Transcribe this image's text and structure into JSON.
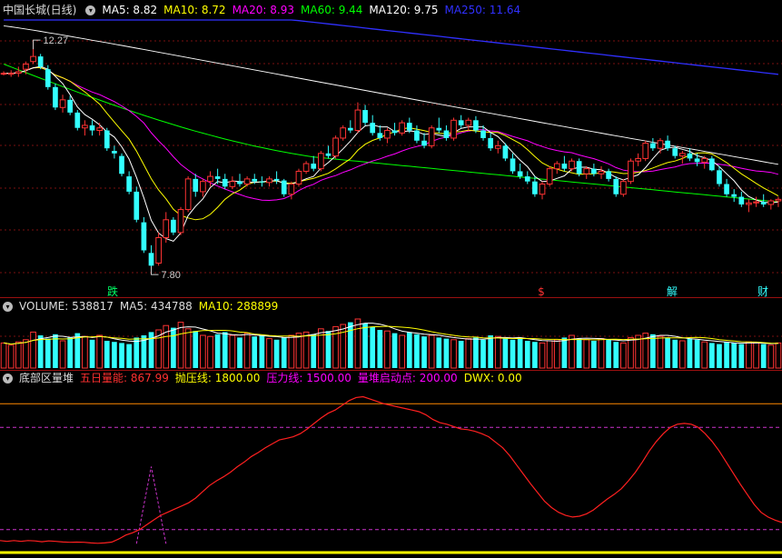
{
  "colors": {
    "ma5": "#ffffff",
    "ma10": "#ffff00",
    "ma20": "#ff00ff",
    "ma60": "#00ff00",
    "ma120": "#ffffff",
    "ma250": "#3030ff",
    "up": "#ff3333",
    "down": "#33ffff",
    "pressure": "#cc33cc",
    "energy": "#ff2020"
  },
  "price_panel": {
    "title": "中国长城(日线)",
    "toggle_icon": "chevron-down-icon",
    "ma": [
      {
        "label": "MA5: 8.82",
        "key": "ma5"
      },
      {
        "label": "MA10: 8.72",
        "key": "ma10"
      },
      {
        "label": "MA20: 8.93",
        "key": "ma20"
      },
      {
        "label": "MA60: 9.44",
        "key": "ma60"
      },
      {
        "label": "MA120: 9.75",
        "key": "ma120"
      },
      {
        "label": "MA250: 11.64",
        "key": "ma250"
      }
    ],
    "high_label": "12.27",
    "low_label": "7.80",
    "event_tags": [
      "跌",
      "$",
      "解",
      "财"
    ]
  },
  "volume_panel": {
    "labels": [
      {
        "text": "VOLUME: 538817",
        "key": "label"
      },
      {
        "text": "MA5: 434788",
        "key": "ma5"
      },
      {
        "text": "MA10: 288899",
        "key": "ma10"
      }
    ]
  },
  "indicator_panel": {
    "title": "底部区量堆",
    "labels": [
      {
        "text": "五日量能: 867.99",
        "key": "energy"
      },
      {
        "text": "抛压线: 1800.00",
        "key": "throw"
      },
      {
        "text": "压力线: 1500.00",
        "key": "pressure"
      },
      {
        "text": "量堆启动点: 200.00",
        "key": "start"
      },
      {
        "text": "DWX: 0.00",
        "key": "dwx"
      }
    ]
  },
  "chart_data": [
    {
      "type": "candlestick",
      "title": "中国长城(日线)",
      "ylim": [
        7.5,
        12.7
      ],
      "annotations": [
        {
          "text": "12.27",
          "value": 12.27
        },
        {
          "text": "7.80",
          "value": 7.8
        }
      ],
      "candles": [
        [
          11.62,
          11.66,
          11.58,
          11.62
        ],
        [
          11.6,
          11.68,
          11.55,
          11.62
        ],
        [
          11.62,
          11.75,
          11.55,
          11.65
        ],
        [
          11.7,
          11.85,
          11.6,
          11.8
        ],
        [
          11.85,
          12.27,
          11.8,
          11.95
        ],
        [
          11.95,
          12.0,
          11.7,
          11.75
        ],
        [
          11.7,
          11.78,
          11.3,
          11.35
        ],
        [
          11.35,
          11.42,
          10.9,
          10.95
        ],
        [
          10.95,
          11.2,
          10.85,
          11.1
        ],
        [
          11.1,
          11.18,
          10.8,
          10.85
        ],
        [
          10.85,
          10.9,
          10.5,
          10.55
        ],
        [
          10.55,
          10.7,
          10.4,
          10.6
        ],
        [
          10.6,
          10.7,
          10.4,
          10.5
        ],
        [
          10.5,
          10.65,
          10.4,
          10.55
        ],
        [
          10.5,
          10.55,
          10.1,
          10.15
        ],
        [
          10.1,
          10.2,
          9.95,
          10.05
        ],
        [
          10.0,
          10.05,
          9.6,
          9.65
        ],
        [
          9.6,
          9.7,
          9.25,
          9.3
        ],
        [
          9.3,
          9.4,
          8.7,
          8.75
        ],
        [
          8.7,
          8.8,
          8.1,
          8.15
        ],
        [
          8.1,
          8.25,
          7.8,
          7.85
        ],
        [
          7.9,
          8.5,
          7.85,
          8.4
        ],
        [
          8.4,
          8.9,
          8.3,
          8.75
        ],
        [
          8.75,
          8.8,
          8.45,
          8.5
        ],
        [
          8.5,
          9.0,
          8.45,
          8.95
        ],
        [
          8.95,
          9.6,
          8.9,
          9.55
        ],
        [
          9.55,
          9.65,
          9.2,
          9.3
        ],
        [
          9.3,
          9.55,
          9.2,
          9.5
        ],
        [
          9.5,
          9.7,
          9.4,
          9.6
        ],
        [
          9.6,
          9.75,
          9.45,
          9.55
        ],
        [
          9.55,
          9.65,
          9.35,
          9.4
        ],
        [
          9.4,
          9.6,
          9.35,
          9.5
        ],
        [
          9.5,
          9.65,
          9.4,
          9.45
        ],
        [
          9.45,
          9.6,
          9.4,
          9.55
        ],
        [
          9.55,
          9.65,
          9.45,
          9.5
        ],
        [
          9.5,
          9.6,
          9.4,
          9.48
        ],
        [
          9.48,
          9.6,
          9.4,
          9.55
        ],
        [
          9.55,
          9.7,
          9.45,
          9.52
        ],
        [
          9.52,
          9.55,
          9.2,
          9.25
        ],
        [
          9.25,
          9.5,
          9.15,
          9.45
        ],
        [
          9.45,
          9.75,
          9.4,
          9.7
        ],
        [
          9.7,
          9.9,
          9.65,
          9.85
        ],
        [
          9.85,
          10.0,
          9.7,
          9.75
        ],
        [
          9.75,
          10.1,
          9.7,
          10.05
        ],
        [
          10.05,
          10.2,
          9.95,
          10.0
        ],
        [
          10.0,
          10.4,
          9.95,
          10.35
        ],
        [
          10.35,
          10.6,
          10.3,
          10.55
        ],
        [
          10.55,
          10.7,
          10.45,
          10.5
        ],
        [
          10.5,
          11.05,
          10.45,
          10.9
        ],
        [
          10.9,
          11.0,
          10.6,
          10.65
        ],
        [
          10.65,
          10.8,
          10.4,
          10.45
        ],
        [
          10.45,
          10.6,
          10.3,
          10.35
        ],
        [
          10.35,
          10.55,
          10.25,
          10.5
        ],
        [
          10.5,
          10.65,
          10.4,
          10.45
        ],
        [
          10.45,
          10.7,
          10.4,
          10.65
        ],
        [
          10.65,
          10.75,
          10.45,
          10.5
        ],
        [
          10.5,
          10.6,
          10.25,
          10.3
        ],
        [
          10.3,
          10.45,
          10.15,
          10.2
        ],
        [
          10.2,
          10.6,
          10.15,
          10.55
        ],
        [
          10.55,
          10.75,
          10.45,
          10.5
        ],
        [
          10.5,
          10.6,
          10.3,
          10.35
        ],
        [
          10.35,
          10.75,
          10.3,
          10.7
        ],
        [
          10.7,
          10.8,
          10.55,
          10.6
        ],
        [
          10.6,
          10.75,
          10.5,
          10.7
        ],
        [
          10.7,
          10.78,
          10.45,
          10.5
        ],
        [
          10.5,
          10.6,
          10.3,
          10.35
        ],
        [
          10.35,
          10.45,
          10.1,
          10.15
        ],
        [
          10.15,
          10.3,
          10.05,
          10.2
        ],
        [
          10.2,
          10.25,
          9.9,
          9.95
        ],
        [
          9.95,
          10.05,
          9.65,
          9.7
        ],
        [
          9.7,
          9.85,
          9.55,
          9.6
        ],
        [
          9.6,
          9.7,
          9.45,
          9.5
        ],
        [
          9.5,
          9.6,
          9.2,
          9.25
        ],
        [
          9.25,
          9.5,
          9.15,
          9.45
        ],
        [
          9.45,
          9.8,
          9.4,
          9.75
        ],
        [
          9.75,
          9.9,
          9.65,
          9.85
        ],
        [
          9.85,
          10.0,
          9.7,
          9.75
        ],
        [
          9.75,
          9.95,
          9.7,
          9.9
        ],
        [
          9.9,
          9.95,
          9.6,
          9.65
        ],
        [
          9.65,
          9.8,
          9.55,
          9.75
        ],
        [
          9.75,
          9.85,
          9.6,
          9.65
        ],
        [
          9.65,
          9.8,
          9.55,
          9.7
        ],
        [
          9.7,
          9.75,
          9.5,
          9.55
        ],
        [
          9.55,
          9.6,
          9.2,
          9.25
        ],
        [
          9.25,
          9.55,
          9.2,
          9.5
        ],
        [
          9.5,
          9.95,
          9.45,
          9.9
        ],
        [
          9.9,
          10.05,
          9.8,
          9.95
        ],
        [
          9.95,
          10.3,
          9.9,
          10.25
        ],
        [
          10.25,
          10.35,
          10.1,
          10.15
        ],
        [
          10.15,
          10.35,
          10.05,
          10.3
        ],
        [
          10.3,
          10.4,
          10.1,
          10.15
        ],
        [
          10.15,
          10.2,
          9.95,
          10.0
        ],
        [
          10.0,
          10.1,
          9.85,
          10.05
        ],
        [
          10.05,
          10.15,
          9.9,
          9.95
        ],
        [
          9.95,
          10.05,
          9.8,
          9.88
        ],
        [
          9.88,
          10.0,
          9.75,
          9.95
        ],
        [
          9.95,
          10.0,
          9.7,
          9.72
        ],
        [
          9.72,
          9.8,
          9.4,
          9.45
        ],
        [
          9.45,
          9.55,
          9.2,
          9.25
        ],
        [
          9.25,
          9.35,
          9.1,
          9.2
        ],
        [
          9.2,
          9.3,
          9.0,
          9.05
        ],
        [
          9.05,
          9.15,
          8.9,
          9.08
        ],
        [
          9.08,
          9.2,
          9.0,
          9.1
        ],
        [
          9.1,
          9.25,
          9.0,
          9.05
        ],
        [
          9.05,
          9.15,
          8.95,
          9.12
        ],
        [
          9.12,
          9.2,
          9.0,
          9.15
        ]
      ]
    },
    {
      "type": "bar",
      "title": "VOLUME",
      "values": [
        230,
        210,
        240,
        260,
        330,
        300,
        270,
        310,
        250,
        280,
        320,
        290,
        260,
        300,
        250,
        240,
        230,
        220,
        280,
        300,
        330,
        350,
        390,
        370,
        420,
        360,
        340,
        300,
        290,
        310,
        330,
        300,
        280,
        320,
        290,
        300,
        270,
        260,
        280,
        300,
        320,
        330,
        310,
        360,
        340,
        380,
        400,
        420,
        450,
        410,
        380,
        350,
        340,
        320,
        300,
        330,
        310,
        290,
        300,
        280,
        270,
        260,
        250,
        270,
        280,
        260,
        300,
        290,
        270,
        260,
        280,
        250,
        240,
        230,
        250,
        260,
        280,
        300,
        270,
        260,
        250,
        270,
        260,
        240,
        230,
        280,
        300,
        320,
        310,
        290,
        280,
        260,
        250,
        270,
        260,
        240,
        230,
        220,
        240,
        230,
        220,
        240,
        230,
        220,
        210,
        230
      ],
      "ylim": [
        0,
        500
      ]
    },
    {
      "type": "line",
      "title": "底部区量堆",
      "series": [
        {
          "name": "五日量能",
          "key": "energy",
          "values": [
            60,
            50,
            60,
            50,
            60,
            55,
            45,
            55,
            50,
            42,
            38,
            40,
            38,
            30,
            25,
            30,
            40,
            80,
            130,
            160,
            200,
            260,
            320,
            380,
            420,
            460,
            500,
            540,
            600,
            680,
            760,
            820,
            870,
            930,
            1000,
            1060,
            1130,
            1180,
            1240,
            1290,
            1340,
            1360,
            1380,
            1420,
            1480,
            1550,
            1620,
            1680,
            1720,
            1780,
            1840,
            1880,
            1890,
            1860,
            1830,
            1800,
            1780,
            1760,
            1740,
            1720,
            1700,
            1660,
            1600,
            1560,
            1540,
            1510,
            1480,
            1470,
            1450,
            1420,
            1380,
            1310,
            1240,
            1140,
            1020,
            900,
            780,
            670,
            560,
            480,
            420,
            380,
            360,
            370,
            400,
            450,
            520,
            590,
            650,
            720,
            820,
            930,
            1060,
            1200,
            1320,
            1420,
            1500,
            1540,
            1550,
            1540,
            1500,
            1420,
            1320,
            1200,
            1060,
            920,
            780,
            650,
            520,
            420,
            360,
            320,
            290
          ]
        }
      ],
      "ylim": [
        0,
        2000
      ],
      "reference_lines": [
        {
          "value": 1800,
          "key": "throw"
        },
        {
          "value": 1500,
          "key": "pressure"
        },
        {
          "value": 200,
          "key": "start"
        },
        {
          "value": 0,
          "key": "dwx"
        }
      ]
    }
  ]
}
